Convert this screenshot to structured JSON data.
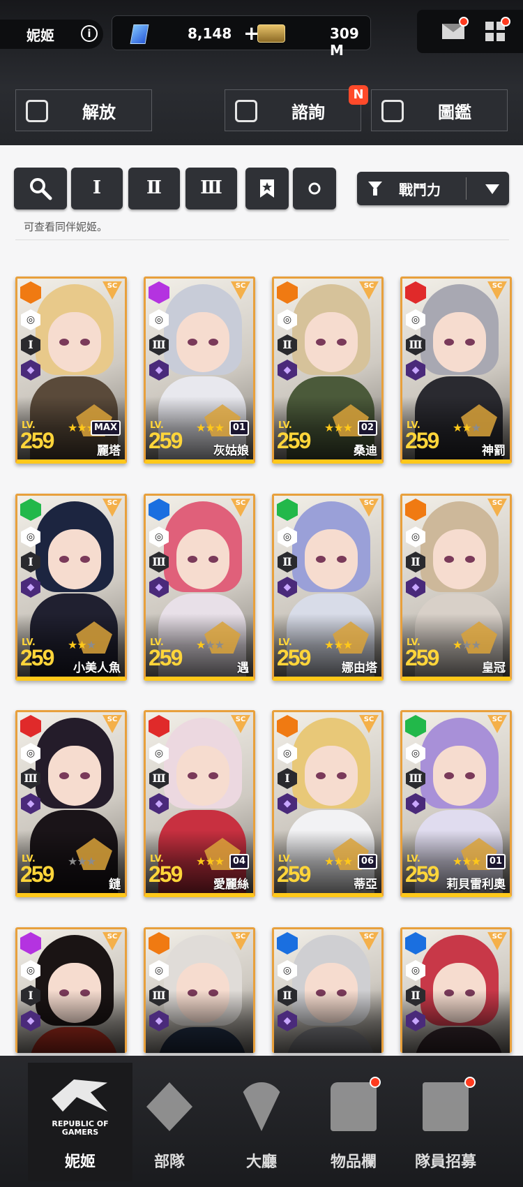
{
  "header": {
    "player_name": "妮姬",
    "gems": "8,148",
    "gems_plus": "+",
    "credits": "309 M",
    "colors": {
      "notification": "#ff3b1f"
    }
  },
  "top_buttons": {
    "liberation": "解放",
    "counsel": "諮詢",
    "counsel_badge": "N",
    "codex": "圖鑑"
  },
  "filters": {
    "burst_1": "Ⅰ",
    "burst_2": "Ⅱ",
    "burst_3": "Ⅲ",
    "sort_label": "戰鬥力",
    "hint": "可查看同伴妮姬。"
  },
  "cards": [
    {
      "name": "麗塔",
      "level": "259",
      "burst": "Ⅰ",
      "stars_on": 3,
      "core": "MAX",
      "element": "core"
    },
    {
      "name": "灰姑娘",
      "level": "259",
      "burst": "Ⅲ",
      "stars_on": 3,
      "core": "01",
      "element": "electric"
    },
    {
      "name": "桑迪",
      "level": "259",
      "burst": "Ⅱ",
      "stars_on": 3,
      "core": "02",
      "element": "core"
    },
    {
      "name": "神罰",
      "level": "259",
      "burst": "Ⅲ",
      "stars_on": 2,
      "core": "",
      "element": "fire"
    },
    {
      "name": "小美人魚",
      "level": "259",
      "burst": "Ⅰ",
      "stars_on": 2,
      "core": "",
      "element": "wind"
    },
    {
      "name": "遇",
      "level": "259",
      "burst": "Ⅲ",
      "stars_on": 1,
      "core": "",
      "element": "water"
    },
    {
      "name": "娜由塔",
      "level": "259",
      "burst": "Ⅱ",
      "stars_on": 3,
      "core": "",
      "element": "wind"
    },
    {
      "name": "皇冠",
      "level": "259",
      "burst": "Ⅱ",
      "stars_on": 1,
      "core": "",
      "element": "core"
    },
    {
      "name": "鏈",
      "level": "259",
      "burst": "Ⅲ",
      "stars_on": 0,
      "core": "",
      "element": "fire"
    },
    {
      "name": "愛麗絲",
      "level": "259",
      "burst": "Ⅲ",
      "stars_on": 3,
      "core": "04",
      "element": "fire"
    },
    {
      "name": "蒂亞",
      "level": "259",
      "burst": "Ⅰ",
      "stars_on": 3,
      "core": "06",
      "element": "core"
    },
    {
      "name": "莉貝雷利奧",
      "level": "259",
      "burst": "Ⅲ",
      "stars_on": 3,
      "core": "01",
      "element": "wind"
    },
    {
      "name": "",
      "level": "",
      "burst": "Ⅰ",
      "stars_on": 0,
      "core": "",
      "element": "electric"
    },
    {
      "name": "",
      "level": "",
      "burst": "Ⅲ",
      "stars_on": 0,
      "core": "",
      "element": "core"
    },
    {
      "name": "",
      "level": "",
      "burst": "Ⅱ",
      "stars_on": 0,
      "core": "",
      "element": "water"
    },
    {
      "name": "",
      "level": "",
      "burst": "Ⅱ",
      "stars_on": 0,
      "core": "",
      "element": "water"
    }
  ],
  "card_labels": {
    "lv": "LV.",
    "sc": "SC"
  },
  "element_colors": {
    "core": "#f07a12",
    "electric": "#b433e0",
    "fire": "#e02a2a",
    "wind": "#22b84a",
    "water": "#1a6fe0"
  },
  "nav": {
    "nikke": "妮姬",
    "squad": "部隊",
    "lobby": "大廳",
    "inventory": "物品欄",
    "recruit": "隊員招募",
    "rog_text": "REPUBLIC OF GAMERS"
  }
}
